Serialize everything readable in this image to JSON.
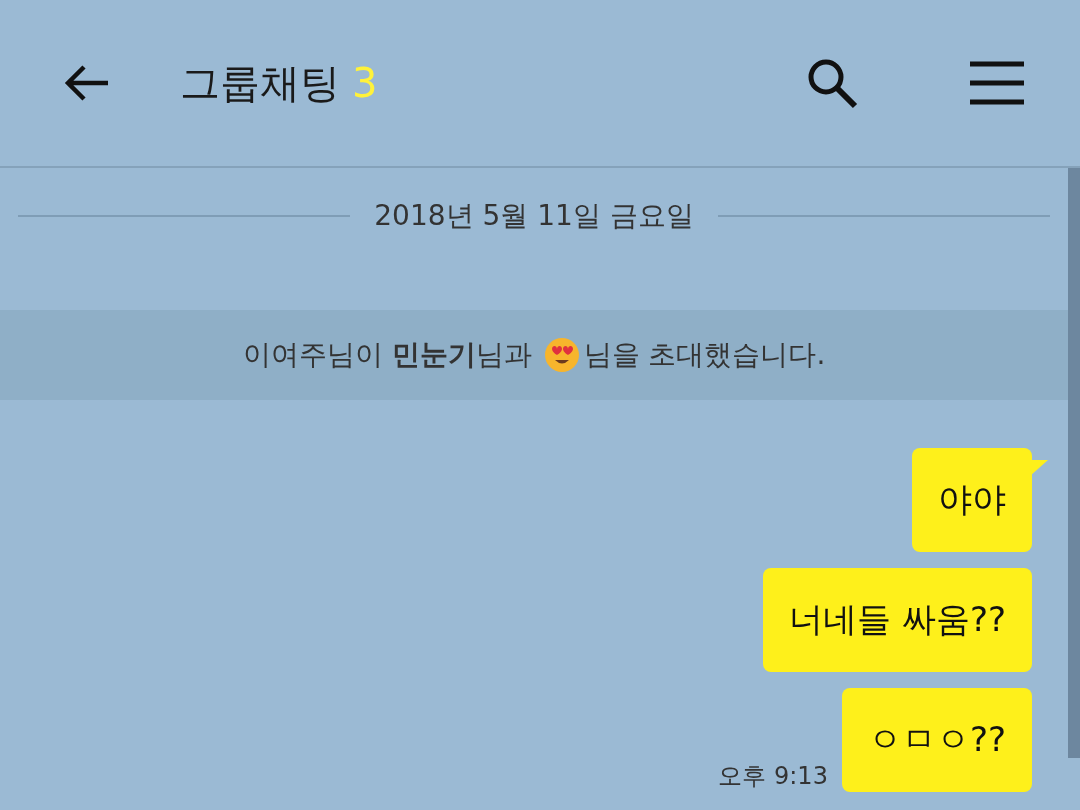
{
  "header": {
    "title": "그룹채팅",
    "member_count": "3"
  },
  "date_divider": "2018년 5월 11일 금요일",
  "system_message": {
    "text_before": "이여주님이 **민눈기**님과",
    "text_after": "님을 초대했습니다."
  },
  "messages": [
    {
      "text": "야야",
      "tail": true
    },
    {
      "text": "너네들 싸움??",
      "tail": false
    },
    {
      "text": "ㅇㅁㅇ??",
      "tail": false,
      "time": "오후 9:13"
    }
  ]
}
